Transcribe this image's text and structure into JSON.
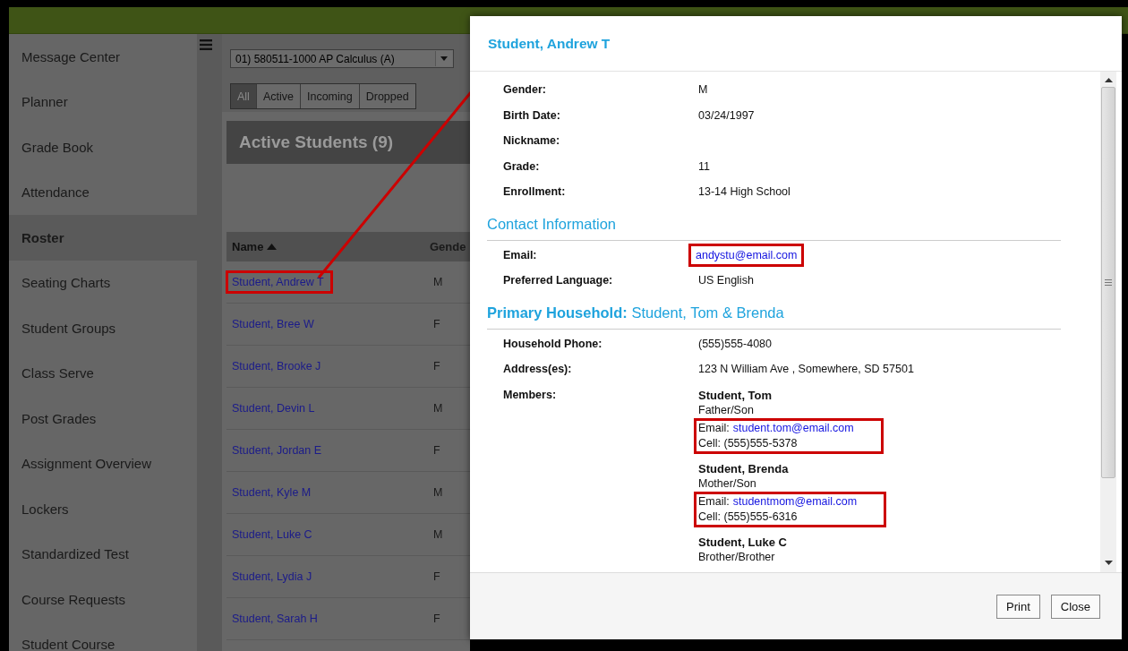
{
  "sidebar": {
    "items": [
      {
        "label": "Message Center",
        "selected": false
      },
      {
        "label": "Planner",
        "selected": false
      },
      {
        "label": "Grade Book",
        "selected": false
      },
      {
        "label": "Attendance",
        "selected": false
      },
      {
        "label": "Roster",
        "selected": true
      },
      {
        "label": "Seating Charts",
        "selected": false
      },
      {
        "label": "Student Groups",
        "selected": false
      },
      {
        "label": "Class Serve",
        "selected": false
      },
      {
        "label": "Post Grades",
        "selected": false
      },
      {
        "label": "Assignment Overview",
        "selected": false
      },
      {
        "label": "Lockers",
        "selected": false
      },
      {
        "label": "Standardized Test",
        "selected": false
      },
      {
        "label": "Course Requests",
        "selected": false
      },
      {
        "label": "Student Course",
        "selected": false
      }
    ]
  },
  "course_select": {
    "value": "01) 580511-1000 AP Calculus (A)"
  },
  "filters": [
    {
      "label": "All",
      "selected": true
    },
    {
      "label": "Active",
      "selected": false
    },
    {
      "label": "Incoming",
      "selected": false
    },
    {
      "label": "Dropped",
      "selected": false
    }
  ],
  "panel_title": "Active Students (9)",
  "table": {
    "columns": [
      {
        "label": "Name",
        "sorted": true
      },
      {
        "label": "Gende"
      }
    ],
    "rows": [
      {
        "name": "Student, Andrew T",
        "gender": "M",
        "highlighted": true
      },
      {
        "name": "Student, Bree W",
        "gender": "F",
        "highlighted": false
      },
      {
        "name": "Student, Brooke J",
        "gender": "F",
        "highlighted": false
      },
      {
        "name": "Student, Devin L",
        "gender": "M",
        "highlighted": false
      },
      {
        "name": "Student, Jordan E",
        "gender": "F",
        "highlighted": false
      },
      {
        "name": "Student, Kyle M",
        "gender": "M",
        "highlighted": false
      },
      {
        "name": "Student, Luke C",
        "gender": "M",
        "highlighted": false
      },
      {
        "name": "Student, Lydia J",
        "gender": "F",
        "highlighted": false
      },
      {
        "name": "Student, Sarah H",
        "gender": "F",
        "highlighted": false
      }
    ]
  },
  "dialog": {
    "title": "Student, Andrew T",
    "sections": [
      {
        "fields": [
          {
            "label": "Gender:",
            "kind": "text",
            "value": "M"
          },
          {
            "label": "Birth Date:",
            "kind": "text",
            "value": "03/24/1997"
          },
          {
            "label": "Nickname:",
            "kind": "text"
          },
          {
            "label": "Grade:",
            "kind": "text",
            "value": "11"
          },
          {
            "label": "Enrollment:",
            "kind": "text",
            "value": "13-14 High School"
          }
        ]
      },
      {
        "heading": "Contact Information",
        "fields": [
          {
            "label": "Email:",
            "kind": "link",
            "value": "andystu@email.com",
            "highlighted": true
          },
          {
            "label": "Preferred Language:",
            "kind": "text",
            "value": "US English"
          }
        ]
      },
      {
        "heading": "**Primary Household:** Student, Tom & Brenda",
        "fields": [
          {
            "label": "Household Phone:",
            "kind": "text",
            "value": "(555)555-4080"
          },
          {
            "label": "Address(es):",
            "kind": "text",
            "value": "123 N William Ave , Somewhere, SD 57501"
          },
          {
            "label": "Members:",
            "kind": "members",
            "members": [
              {
                "name": "Student, Tom",
                "relation": "Father/Son",
                "email_label": "Email:",
                "email": "student.tom@email.com",
                "cell": "Cell: (555)555-5378",
                "highlighted": true
              },
              {
                "name": "Student, Brenda",
                "relation": "Mother/Son",
                "email_label": "Email:",
                "email": "studentmom@email.com",
                "cell": "Cell: (555)555-6316",
                "highlighted": true
              },
              {
                "name": "Student, Luke C",
                "relation": "Brother/Brother"
              }
            ]
          }
        ]
      }
    ],
    "buttons": [
      "Print",
      "Close"
    ]
  }
}
